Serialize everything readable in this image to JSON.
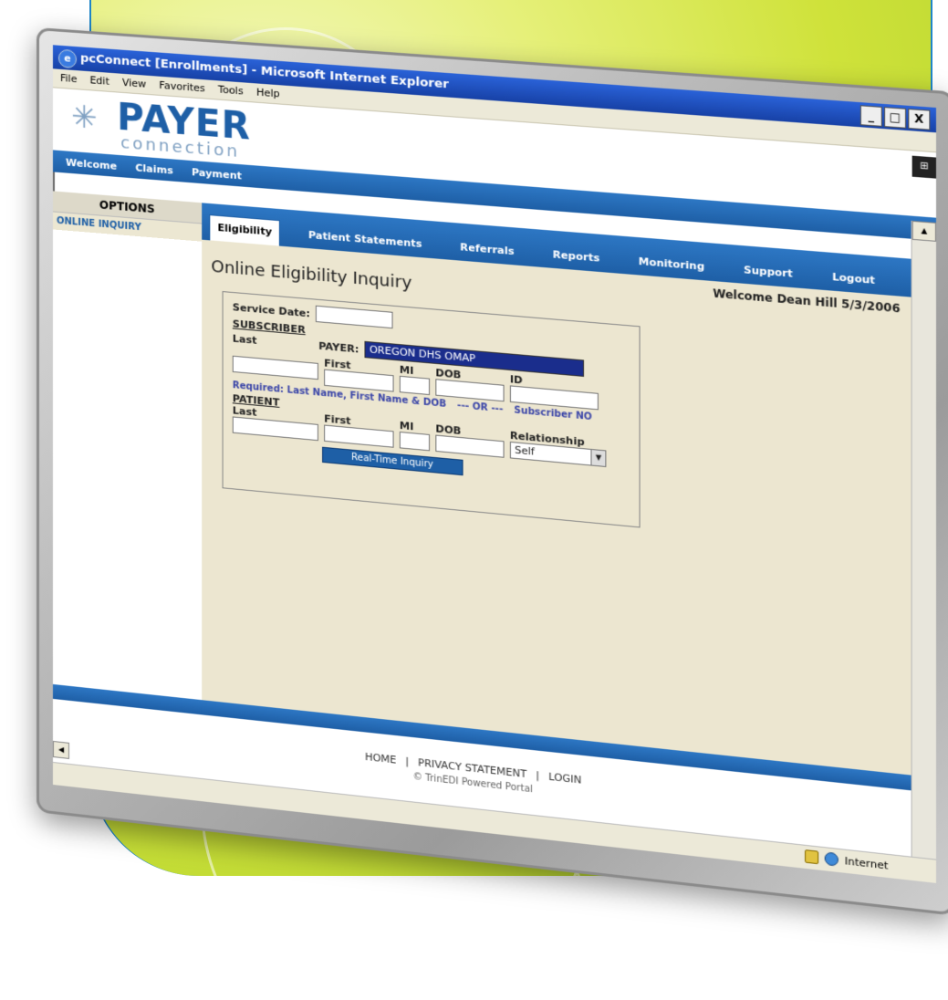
{
  "window": {
    "title": "pcConnect [Enrollments] - Microsoft Internet Explorer",
    "menu": [
      "File",
      "Edit",
      "View",
      "Favorites",
      "Tools",
      "Help"
    ],
    "buttons": [
      "_",
      "□",
      "X"
    ]
  },
  "logo": {
    "main": "PAYER",
    "sub": "connection"
  },
  "nav": {
    "primary": [
      "Welcome",
      "Claims",
      "Payment",
      "Eligibility",
      "Patient Statements",
      "Referrals",
      "Reports",
      "Monitoring",
      "Support",
      "Logout"
    ],
    "active": "Eligibility"
  },
  "sidebar": {
    "heading": "OPTIONS",
    "items": [
      "ONLINE INQUIRY"
    ]
  },
  "page": {
    "title": "Online Eligibility Inquiry",
    "welcome": "Welcome Dean Hill 5/3/2006"
  },
  "form": {
    "service_date_label": "Service Date:",
    "subscriber_label": "SUBSCRIBER",
    "last_label": "Last",
    "first_label": "First",
    "mi_label": "MI",
    "dob_label": "DOB",
    "id_label": "ID",
    "payer_label": "PAYER:",
    "payer_value": "OREGON DHS OMAP",
    "required_text": "Required: Last Name, First Name & DOB",
    "or_text": "--- OR ---",
    "subscriber_no_text": "Subscriber NO",
    "patient_label": "PATIENT",
    "relationship_label": "Relationship",
    "relationship_value": "Self",
    "button_label": "Real-Time Inquiry"
  },
  "footer": {
    "links": [
      "HOME",
      "PRIVACY STATEMENT",
      "LOGIN"
    ],
    "copyright": "© TrinEDI Powered Portal"
  },
  "status": {
    "zone": "Internet"
  },
  "colors": {
    "nav_blue": "#1e5fa6",
    "form_bg": "#ece6d0",
    "payer_highlight": "#1a2d8c",
    "background_green": "#cfe23a"
  }
}
